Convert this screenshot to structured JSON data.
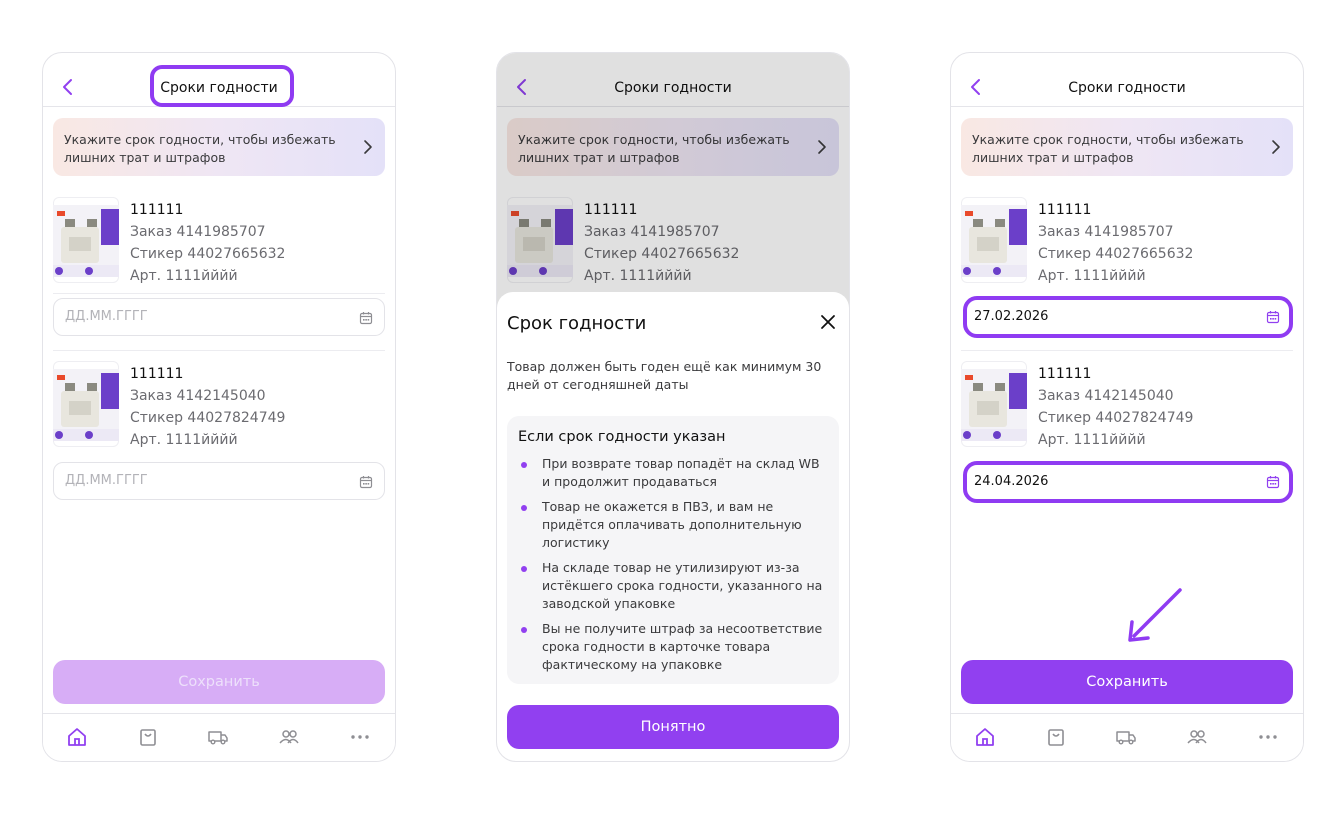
{
  "colors": {
    "accent": "#9140f0",
    "highlight": "#8f3bf2",
    "disabled": "#d7adf6"
  },
  "header": {
    "title": "Сроки годности"
  },
  "banner": {
    "text": "Укажите срок годности, чтобы избежать лишних трат и штрафов"
  },
  "items": [
    {
      "name": "111111",
      "order": "Заказ 4141985707",
      "sticker": "Стикер 44027665632",
      "article": "Арт. 1111йййй"
    },
    {
      "name": "111111",
      "order": "Заказ 4142145040",
      "sticker": "Стикер 44027824749",
      "article": "Арт. 1111йййй"
    }
  ],
  "date_placeholder": "ДД.ММ.ГГГГ",
  "filled_dates": [
    "27.02.2026",
    "24.04.2026"
  ],
  "save_label": "Сохранить",
  "tabs": [
    {
      "icon": "home-icon"
    },
    {
      "icon": "bag-icon"
    },
    {
      "icon": "delivery-truck-icon"
    },
    {
      "icon": "users-icon"
    },
    {
      "icon": "more-icon"
    }
  ],
  "sheet": {
    "title": "Срок годности",
    "description": "Товар должен быть годен ещё как минимум 30 дней от сегодняшней даты",
    "box_title": "Если срок годности указан",
    "bullets": [
      "При возврате товар попадёт на склад WB и продолжит продаваться",
      "Товар не окажется в ПВЗ, и вам не придётся оплачивать дополнительную логистику",
      "На складе товар не утилизируют из-за истёкшего срока годности, указанного на заводской упаковке",
      "Вы не получите штраф за несоответствие срока годности в карточке товара фактическому на упаковке"
    ],
    "button": "Понятно"
  }
}
